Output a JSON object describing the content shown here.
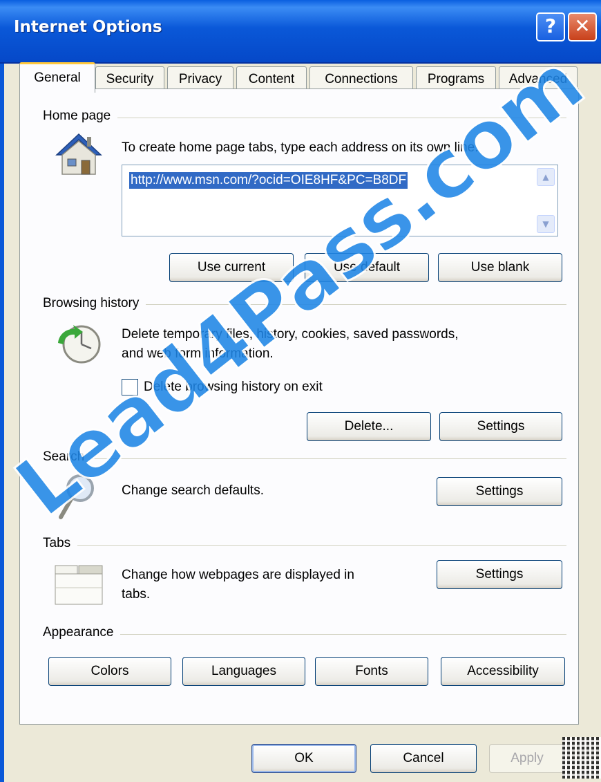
{
  "window": {
    "title": "Internet Options",
    "help_glyph": "?",
    "close_glyph": "✕"
  },
  "tabs": [
    {
      "label": "General",
      "active": true
    },
    {
      "label": "Security"
    },
    {
      "label": "Privacy"
    },
    {
      "label": "Content"
    },
    {
      "label": "Connections"
    },
    {
      "label": "Programs"
    },
    {
      "label": "Advanced"
    }
  ],
  "home_page": {
    "group_label": "Home page",
    "instructions": "To create home page tabs, type each address on its own line.",
    "address_value": "http://www.msn.com/?ocid=OIE8HF&PC=B8DF",
    "buttons": {
      "use_current": "Use current",
      "use_default": "Use default",
      "use_blank": "Use blank"
    },
    "icon": "house-icon"
  },
  "browsing_history": {
    "group_label": "Browsing history",
    "description_line1": "Delete temporary files, history, cookies, saved passwords,",
    "description_line2": "and web form information.",
    "checkbox_label": "Delete browsing history on exit",
    "checkbox_checked": false,
    "buttons": {
      "delete": "Delete...",
      "settings": "Settings"
    },
    "icon": "clock-history-icon"
  },
  "search": {
    "group_label": "Search",
    "description": "Change search defaults.",
    "settings_button": "Settings",
    "icon": "magnifier-icon"
  },
  "tabs_group": {
    "group_label": "Tabs",
    "description_line1": "Change how webpages are displayed in",
    "description_line2": "tabs.",
    "settings_button": "Settings",
    "icon": "tabs-window-icon"
  },
  "appearance": {
    "group_label": "Appearance",
    "buttons": {
      "colors": "Colors",
      "languages": "Languages",
      "fonts": "Fonts",
      "accessibility": "Accessibility"
    }
  },
  "footer": {
    "ok": "OK",
    "cancel": "Cancel",
    "apply": "Apply",
    "apply_enabled": false
  },
  "watermark": {
    "text": "Lead4Pass.com",
    "color": "#1f86e6"
  },
  "colors": {
    "titlebar": "#0a58d8",
    "dialog_bg": "#ece9d8",
    "active_tab_accent": "#ffc83c",
    "selection": "#316ac5",
    "button_border": "#003c74"
  }
}
